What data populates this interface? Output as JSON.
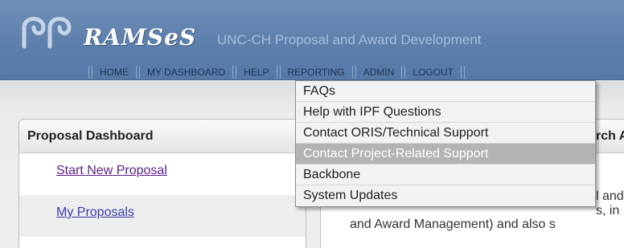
{
  "header": {
    "brand": "RAMSeS",
    "tagline": "UNC-CH Proposal and Award Development",
    "nav": [
      {
        "label": "HOME"
      },
      {
        "label": "MY DASHBOARD"
      },
      {
        "label": "HELP"
      },
      {
        "label": "REPORTING"
      },
      {
        "label": "ADMIN"
      },
      {
        "label": "LOGOUT"
      }
    ]
  },
  "help_menu": {
    "items": [
      {
        "label": "FAQs"
      },
      {
        "label": "Help with IPF Questions"
      },
      {
        "label": "Contact ORIS/Technical Support"
      },
      {
        "label": "Contact Project-Related Support",
        "highlighted": true
      },
      {
        "label": "Backbone"
      },
      {
        "label": "System Updates"
      }
    ]
  },
  "dashboard": {
    "title": "Proposal Dashboard",
    "links": [
      {
        "label": "Start New Proposal"
      },
      {
        "label": "My Proposals"
      }
    ]
  },
  "right_panel": {
    "title_fragment": "rch A",
    "text_fragments": [
      "l and",
      "s, in",
      "and Award Management)  and also s"
    ]
  },
  "colors": {
    "header_blue": "#5d7fab",
    "nav_text": "#22344f",
    "menu_highlight": "#b3b3b3",
    "link_visited": "#5a1e8c"
  }
}
